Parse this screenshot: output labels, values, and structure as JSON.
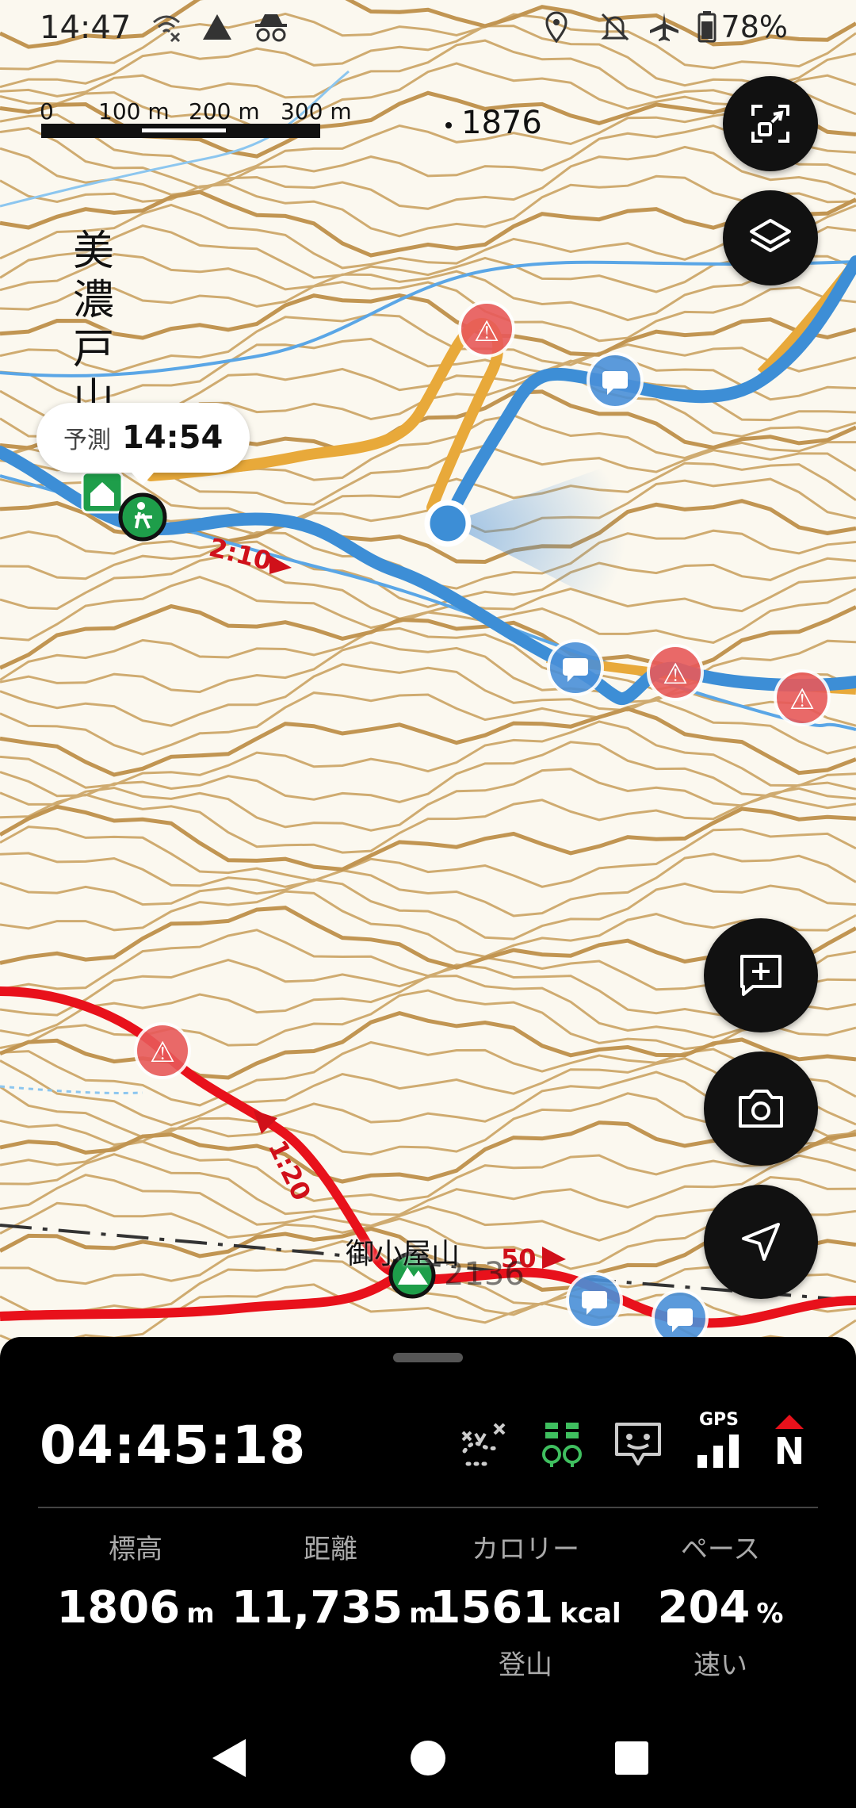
{
  "status_bar": {
    "time": "14:47",
    "battery": "78%",
    "icons": [
      "wifi-off-icon",
      "warning-triangle-icon",
      "incognito-icon",
      "location-icon",
      "bell-off-icon",
      "airplane-icon",
      "battery-icon"
    ]
  },
  "map": {
    "scale": {
      "labels": [
        "0",
        "100 m",
        "200 m",
        "300 m"
      ]
    },
    "peak_label": "1876",
    "area_label": "美濃戸山",
    "summit_label": "御小屋山",
    "summit_elevation_partial": "2136",
    "eta": {
      "label": "予測",
      "time": "14:54"
    },
    "route_times": [
      "2:10",
      "1:20",
      "50"
    ],
    "colors": {
      "route_blue": "#3d8ed6",
      "route_red": "#e8111b",
      "route_orange": "#e8a93a",
      "contour": "#c9a56a",
      "river": "#5aa6e6",
      "warning": "#e85a5a",
      "comment": "#4a90d9"
    }
  },
  "fab_buttons": {
    "fit": "fit-screen-icon",
    "layers": "layers-icon",
    "add_note": "add-comment-icon",
    "camera": "camera-icon",
    "locate": "navigation-arrow-icon"
  },
  "panel": {
    "timer": "04:45:18",
    "icons": [
      "route-off-icon",
      "companions-icon",
      "comment-icon",
      "gps-signal-icon",
      "north-compass-icon"
    ],
    "gps_label": "GPS",
    "north_label": "N",
    "stats": [
      {
        "label": "標高",
        "value": "1806",
        "unit": "m",
        "sub": ""
      },
      {
        "label": "距離",
        "value": "11,735",
        "unit": "m",
        "sub": ""
      },
      {
        "label": "カロリー",
        "value": "1561",
        "unit": "kcal",
        "sub": "登山"
      },
      {
        "label": "ペース",
        "value": "204",
        "unit": "%",
        "sub": "速い"
      }
    ]
  },
  "nav_bar": [
    "back-icon",
    "home-icon",
    "recents-icon"
  ]
}
